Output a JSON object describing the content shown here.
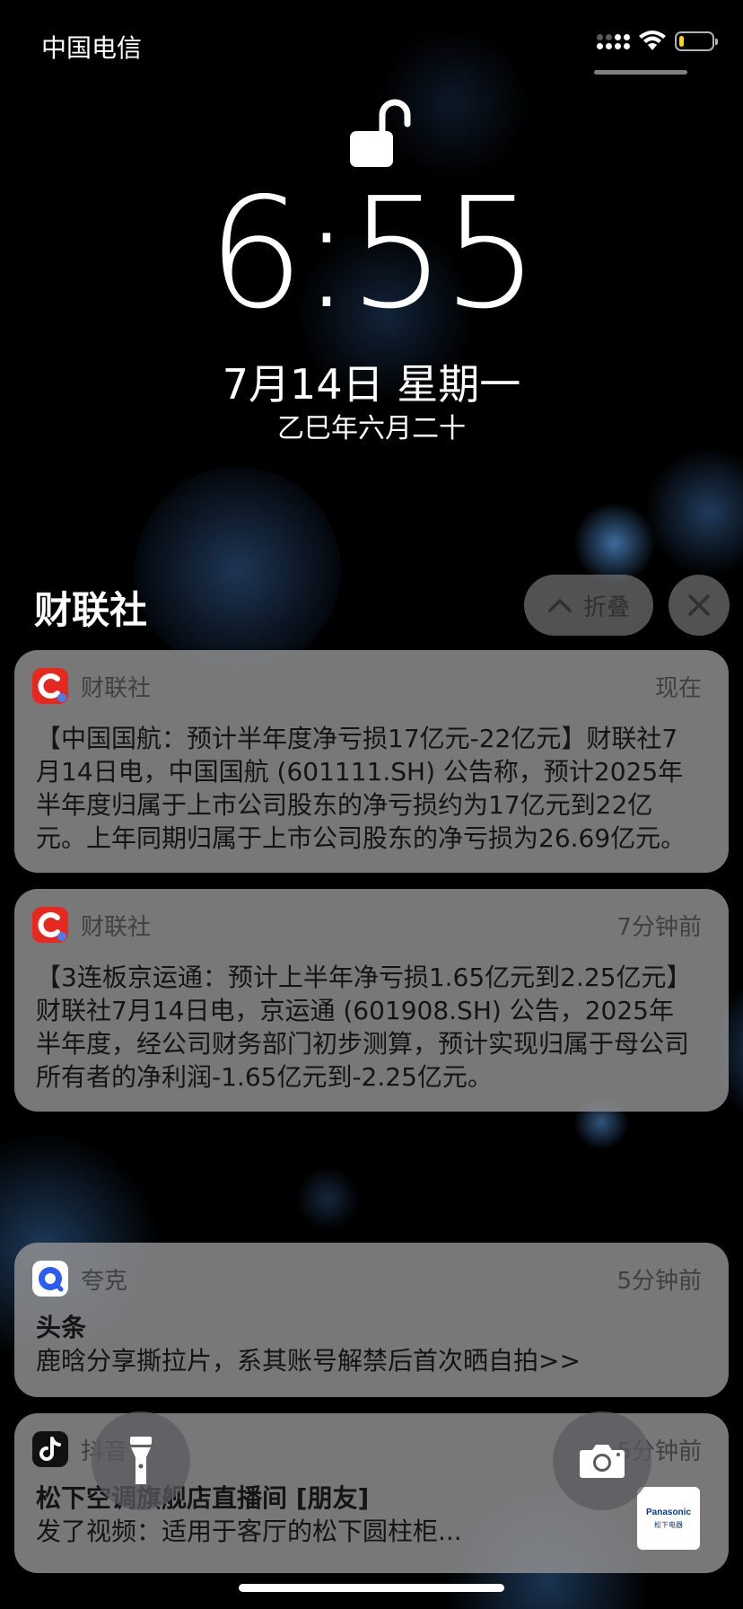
{
  "status_bar": {
    "carrier": "中国电信",
    "battery_level": 0.15,
    "battery_color": "#ffd60a"
  },
  "lock_screen": {
    "time": "6:55",
    "date": "7月14日 星期一",
    "lunar_date": "乙巳年六月二十"
  },
  "group": {
    "title": "财联社",
    "collapse_label": "折叠",
    "close_icon": "close-icon"
  },
  "notifications": [
    {
      "app": "财联社",
      "time": "现在",
      "body": "【中国国航：预计半年度净亏损17亿元-22亿元】财联社7月14日电，中国国航 (601111.SH) 公告称，预计2025年半年度归属于上市公司股东的净亏损约为17亿元到22亿元。上年同期归属于上市公司股东的净亏损为26.69亿元。"
    },
    {
      "app": "财联社",
      "time": "7分钟前",
      "body": "【3连板京运通：预计上半年净亏损1.65亿元到2.25亿元】财联社7月14日电，京运通 (601908.SH) 公告，2025年半年度，经公司财务部门初步测算，预计实现归属于母公司所有者的净利润-1.65亿元到-2.25亿元。"
    },
    {
      "app": "夸克",
      "time": "5分钟前",
      "title": "头条",
      "body": "鹿晗分享撕拉片，系其账号解禁后首次晒自拍>>"
    },
    {
      "app": "抖音",
      "time": "5分钟前",
      "title": "松下空调旗舰店直播间 [朋友]",
      "body": "发了视频：适用于客厅的松下圆柱柜...",
      "thumbnail_brand": "Panasonic",
      "thumbnail_sub": "松下电器"
    }
  ],
  "quick_actions": {
    "flashlight_icon": "flashlight-icon",
    "camera_icon": "camera-icon"
  }
}
